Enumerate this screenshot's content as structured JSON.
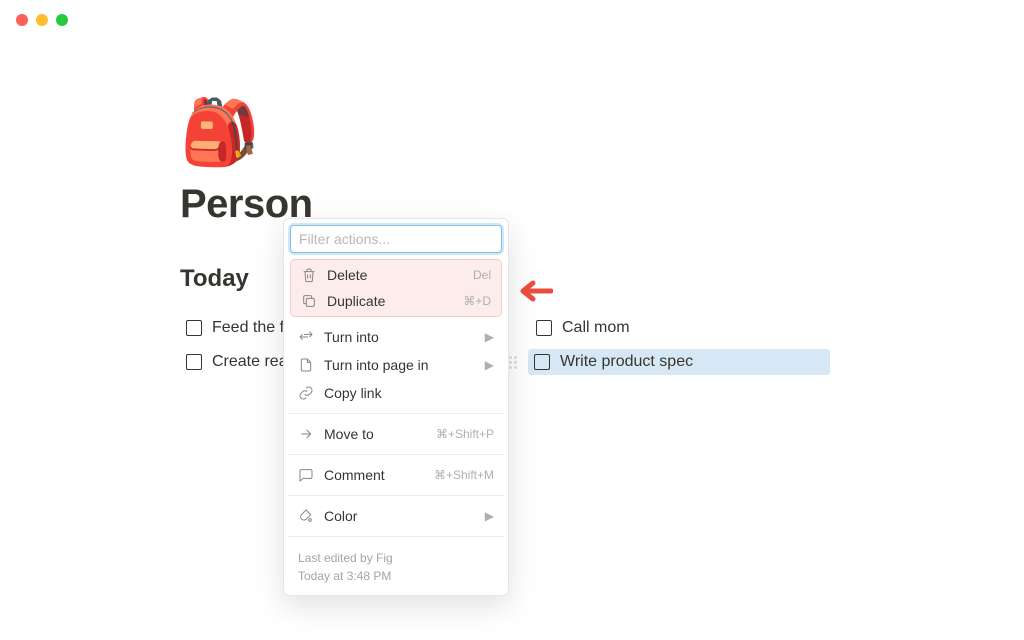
{
  "page": {
    "icon": "🎒",
    "title": "Person",
    "section": "Today",
    "col1": [
      {
        "label": "Feed the fis"
      },
      {
        "label": "Create reac"
      }
    ],
    "col2": [
      {
        "label": "Call mom",
        "highlight": false
      },
      {
        "label": "Write product spec",
        "highlight": true,
        "handle": true
      }
    ]
  },
  "menu": {
    "filter_placeholder": "Filter actions...",
    "highlighted": [
      {
        "label": "Delete",
        "shortcut": "Del",
        "icon": "trash"
      },
      {
        "label": "Duplicate",
        "shortcut": "⌘+D",
        "icon": "duplicate"
      }
    ],
    "group1": [
      {
        "label": "Turn into",
        "submenu": true,
        "icon": "swap"
      },
      {
        "label": "Turn into page in",
        "submenu": true,
        "icon": "page"
      },
      {
        "label": "Copy link",
        "icon": "link"
      }
    ],
    "group2": [
      {
        "label": "Move to",
        "shortcut": "⌘+Shift+P",
        "icon": "move"
      }
    ],
    "group3": [
      {
        "label": "Comment",
        "shortcut": "⌘+Shift+M",
        "icon": "comment"
      }
    ],
    "group4": [
      {
        "label": "Color",
        "submenu": true,
        "icon": "color"
      }
    ],
    "meta": {
      "line1": "Last edited by Fig",
      "line2": "Today at 3:48 PM"
    }
  }
}
